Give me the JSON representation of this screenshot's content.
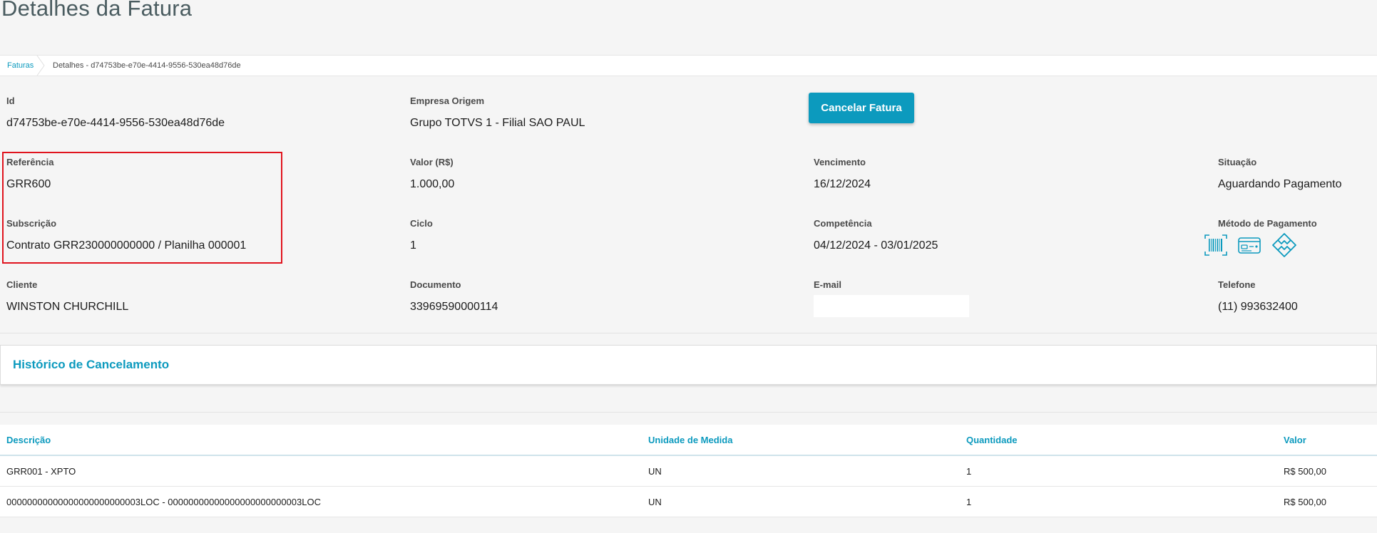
{
  "page": {
    "title": "Detalhes da Fatura"
  },
  "breadcrumb": {
    "parent": "Faturas",
    "current": "Detalhes - d74753be-e70e-4414-9556-530ea48d76de"
  },
  "actions": {
    "cancel_label": "Cancelar Fatura"
  },
  "fields": {
    "id": {
      "label": "Id",
      "value": "d74753be-e70e-4414-9556-530ea48d76de"
    },
    "empresa": {
      "label": "Empresa Origem",
      "value": "Grupo TOTVS 1 - Filial SAO PAUL"
    },
    "referencia": {
      "label": "Referência",
      "value": "GRR600"
    },
    "valor": {
      "label": "Valor (R$)",
      "value": "1.000,00"
    },
    "vencimento": {
      "label": "Vencimento",
      "value": "16/12/2024"
    },
    "situacao": {
      "label": "Situação",
      "value": "Aguardando Pagamento"
    },
    "subscricao": {
      "label": "Subscrição",
      "value": "Contrato GRR230000000000 / Planilha 000001"
    },
    "ciclo": {
      "label": "Ciclo",
      "value": "1"
    },
    "competencia": {
      "label": "Competência",
      "value": "04/12/2024 - 03/01/2025"
    },
    "metodo": {
      "label": "Método de Pagamento",
      "icons": [
        "barcode-boleto-icon",
        "credit-card-icon",
        "pix-icon"
      ]
    },
    "cliente": {
      "label": "Cliente",
      "value": "WINSTON CHURCHILL"
    },
    "documento": {
      "label": "Documento",
      "value": "33969590000114"
    },
    "email": {
      "label": "E-mail",
      "value": ""
    },
    "telefone": {
      "label": "Telefone",
      "value": "(11) 993632400"
    }
  },
  "history": {
    "title": "Histórico de Cancelamento"
  },
  "items_table": {
    "columns": [
      "Descrição",
      "Unidade de Medida",
      "Quantidade",
      "Valor"
    ],
    "rows": [
      [
        "GRR001 - XPTO",
        "UN",
        "1",
        "R$ 500,00"
      ],
      [
        "00000000000000000000000003LOC - 00000000000000000000000003LOC",
        "UN",
        "1",
        "R$ 500,00"
      ]
    ]
  },
  "colors": {
    "accent": "#0c9abe",
    "highlight_border": "#e0141e",
    "background": "#f5f5f5"
  }
}
